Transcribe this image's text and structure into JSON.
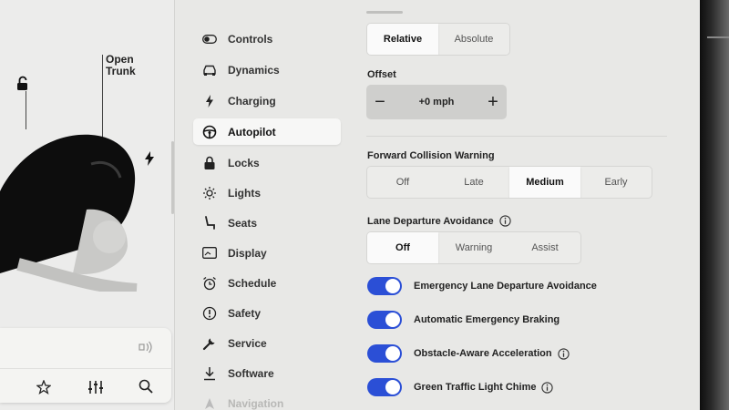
{
  "car": {
    "trunk_label": "Open\nTrunk"
  },
  "menu": {
    "items": [
      {
        "label": "Controls",
        "icon": "toggle-icon"
      },
      {
        "label": "Dynamics",
        "icon": "car-icon"
      },
      {
        "label": "Charging",
        "icon": "bolt-icon"
      },
      {
        "label": "Autopilot",
        "icon": "steering-wheel-icon",
        "active": true
      },
      {
        "label": "Locks",
        "icon": "lock-icon"
      },
      {
        "label": "Lights",
        "icon": "sun-icon"
      },
      {
        "label": "Seats",
        "icon": "seat-icon"
      },
      {
        "label": "Display",
        "icon": "display-icon"
      },
      {
        "label": "Schedule",
        "icon": "alarm-clock-icon"
      },
      {
        "label": "Safety",
        "icon": "alert-circle-icon"
      },
      {
        "label": "Service",
        "icon": "wrench-icon"
      },
      {
        "label": "Software",
        "icon": "download-icon"
      },
      {
        "label": "Navigation",
        "icon": "navigation-icon"
      }
    ]
  },
  "autopilot": {
    "speed_mode": {
      "options": [
        "Relative",
        "Absolute"
      ],
      "selected": "Relative"
    },
    "offset": {
      "label": "Offset",
      "value": "+0 mph",
      "minus": "−",
      "plus": "+"
    },
    "fcw": {
      "label": "Forward Collision Warning",
      "options": [
        "Off",
        "Late",
        "Medium",
        "Early"
      ],
      "selected": "Medium"
    },
    "lda": {
      "label": "Lane Departure Avoidance",
      "options": [
        "Off",
        "Warning",
        "Assist"
      ],
      "selected": "Off"
    },
    "toggles": [
      {
        "label": "Emergency Lane Departure Avoidance",
        "on": true,
        "info": false
      },
      {
        "label": "Automatic Emergency Braking",
        "on": true,
        "info": false
      },
      {
        "label": "Obstacle-Aware Acceleration",
        "on": true,
        "info": true
      },
      {
        "label": "Green Traffic Light Chime",
        "on": true,
        "info": true
      }
    ]
  },
  "colors": {
    "toggle_on": "#2b4fd6",
    "screen_bg": "#e8e8e6"
  }
}
